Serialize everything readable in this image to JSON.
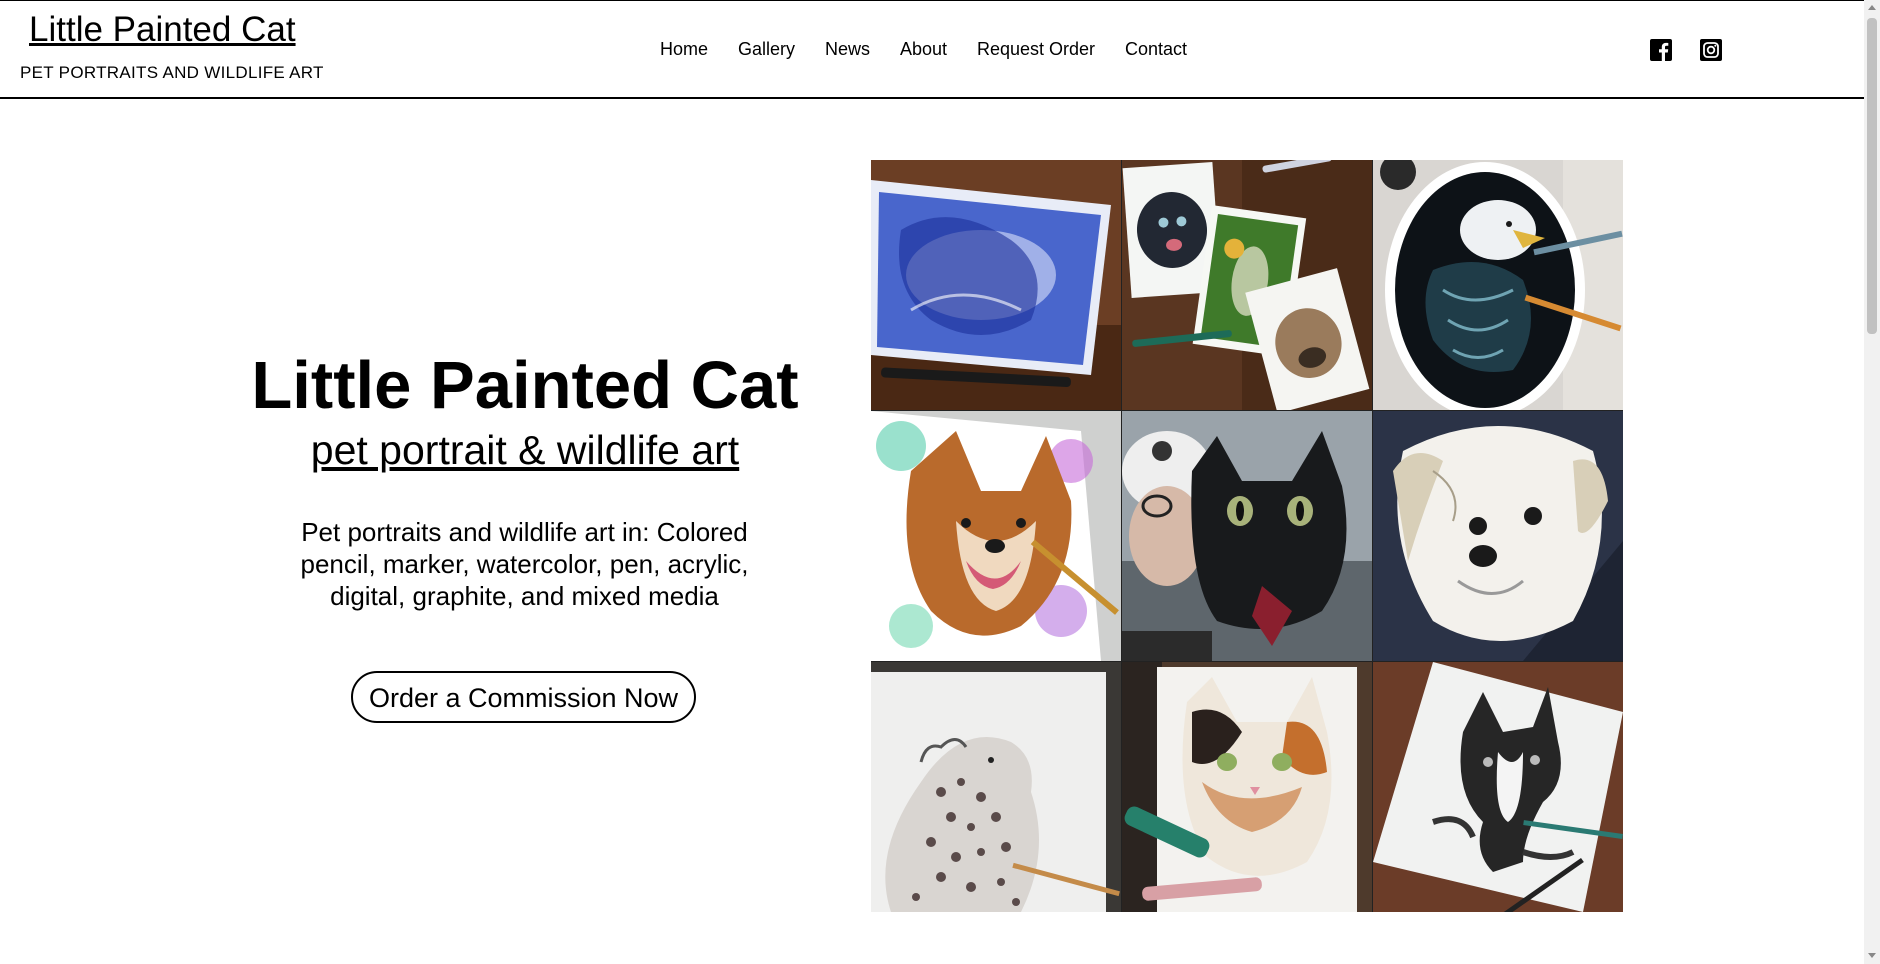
{
  "header": {
    "site_title": "Little Painted Cat",
    "tagline": "PET PORTRAITS AND WILDLIFE ART",
    "nav": [
      {
        "label": "Home"
      },
      {
        "label": "Gallery"
      },
      {
        "label": "News"
      },
      {
        "label": "About"
      },
      {
        "label": "Request Order"
      },
      {
        "label": "Contact"
      }
    ],
    "social": [
      {
        "icon": "facebook-icon"
      },
      {
        "icon": "instagram-icon"
      }
    ]
  },
  "hero": {
    "title": "Little Painted Cat",
    "subtitle": "pet portrait & wildlife art",
    "description": "Pet portraits and wildlife art in: Colored pencil, marker, watercolor, pen, acrylic, digital, graphite, and mixed media",
    "cta_label": "Order a Commission Now"
  },
  "gallery": {
    "tiles": [
      {
        "name": "blue-pen-lion-artwork"
      },
      {
        "name": "dog-and-nature-cards-artwork"
      },
      {
        "name": "bald-eagle-oval-artwork"
      },
      {
        "name": "fox-dog-watercolor-artwork"
      },
      {
        "name": "black-cat-selfie-photo"
      },
      {
        "name": "white-dog-portrait-artwork"
      },
      {
        "name": "snow-leopard-pencil-artwork"
      },
      {
        "name": "calico-cat-watercolor-artwork"
      },
      {
        "name": "boston-terrier-graphite-artwork"
      }
    ]
  },
  "colors": {
    "text": "#000000",
    "background": "#ffffff",
    "border": "#000000"
  }
}
